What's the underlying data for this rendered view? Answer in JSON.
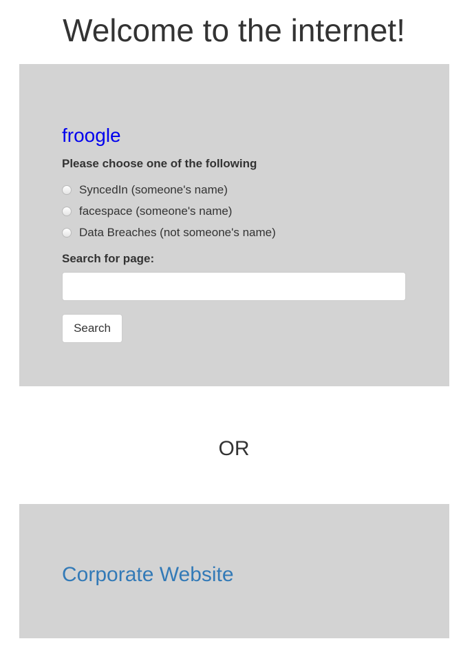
{
  "header": {
    "title": "Welcome to the internet!"
  },
  "search_panel": {
    "brand_link": "froogle",
    "choose_label": "Please choose one of the following",
    "options": [
      {
        "label": "SyncedIn (someone's name)",
        "selected": false
      },
      {
        "label": "facespace (someone's name)",
        "selected": false
      },
      {
        "label": "Data Breaches (not someone's name)",
        "selected": false
      }
    ],
    "search_label": "Search for page:",
    "search_value": "",
    "search_placeholder": "",
    "search_button_label": "Search"
  },
  "separator": {
    "text": "OR"
  },
  "corporate_panel": {
    "link_text": "Corporate Website"
  },
  "colors": {
    "panel_background": "#d3d3d3",
    "brand_link": "#0000ee",
    "corporate_link": "#337ab7",
    "text": "#333333"
  }
}
